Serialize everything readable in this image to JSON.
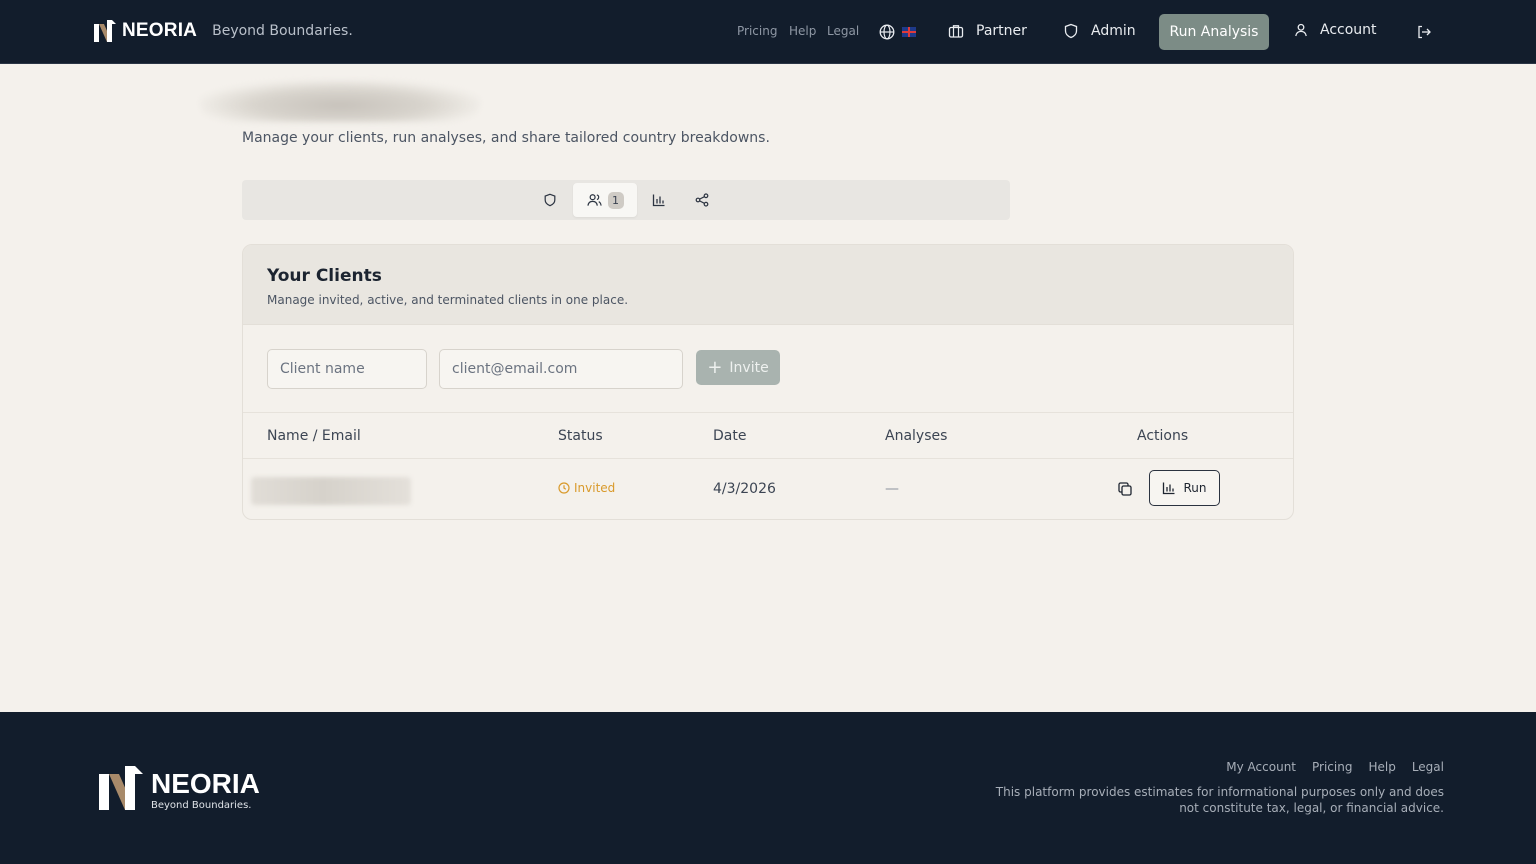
{
  "header": {
    "brand_name": "NEORIA",
    "tagline": "Beyond Boundaries.",
    "nav_small": [
      "Pricing",
      "Help",
      "Legal"
    ],
    "language_flag": "🇬🇧",
    "partner_label": "Partner",
    "admin_label": "Admin",
    "run_analysis_label": "Run Analysis",
    "account_label": "Account"
  },
  "page": {
    "subtitle": "Manage your clients, run analyses, and share tailored country breakdowns.",
    "tabs": [
      {
        "icon": "shield-icon"
      },
      {
        "icon": "users-icon",
        "badge": "1"
      },
      {
        "icon": "bar-chart-icon"
      },
      {
        "icon": "share-icon"
      }
    ]
  },
  "clients": {
    "title": "Your Clients",
    "description": "Manage invited, active, and terminated clients in one place.",
    "name_placeholder": "Client name",
    "email_placeholder": "client@email.com",
    "invite_label": "Invite",
    "columns": [
      "Name / Email",
      "Status",
      "Date",
      "Analyses",
      "Actions"
    ],
    "rows": [
      {
        "status": "Invited",
        "date": "4/3/2026",
        "analyses": "—",
        "run_label": "Run"
      }
    ]
  },
  "footer": {
    "brand_name": "NEORIA",
    "tagline": "Beyond Boundaries.",
    "links": [
      "My Account",
      "Pricing",
      "Help",
      "Legal"
    ],
    "disclaimer": "This platform provides estimates for informational purposes only and does not constitute tax, legal, or financial advice."
  },
  "colors": {
    "navy": "#121d2c",
    "background": "#f4f1ec",
    "accent_sage": "#7c8c86",
    "status_invited": "#d99a2b"
  }
}
